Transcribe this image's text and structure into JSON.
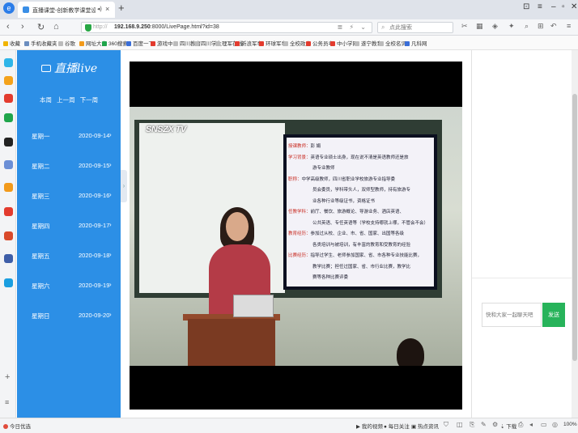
{
  "browser": {
    "tab_title": "直播课堂-创新教学课堂设计",
    "url_prefix": "http://",
    "url_host": "192.168.9.250",
    "url_rest": ":8000/LivePage.html?id=38",
    "search_placeholder": "点此搜索",
    "new_tab": "+",
    "win_controls": [
      "⊡",
      "☰",
      "–",
      "❐",
      "✕"
    ]
  },
  "bookmarks": [
    {
      "label": "收藏",
      "color": "#f0b400"
    },
    {
      "label": "手机收藏夹",
      "color": "#6c8ebf"
    },
    {
      "label": "谷歌",
      "color": "#bbbbbb"
    },
    {
      "label": "网址大全",
      "color": "#f29a1b"
    },
    {
      "label": "360搜索",
      "color": "#1fa54b"
    },
    {
      "label": "百度一下",
      "color": "#3a6ed8"
    },
    {
      "label": "游戏中心",
      "color": "#e33b2e"
    },
    {
      "label": "四川教育",
      "color": "#bbbbbb"
    },
    {
      "label": "四川学生",
      "color": "#bbbbbb"
    },
    {
      "label": "理军在线",
      "color": "#bbbbbb"
    },
    {
      "label": "新浪军事",
      "color": "#e33b2e"
    },
    {
      "label": "环球军事",
      "color": "#e33b2e"
    },
    {
      "label": "全校政府",
      "color": "#bbbbbb"
    },
    {
      "label": "公务员考",
      "color": "#e33b2e"
    },
    {
      "label": "中小学网",
      "color": "#e33b2e"
    },
    {
      "label": "遂宁教育",
      "color": "#bbbbbb"
    },
    {
      "label": "全校名词",
      "color": "#bbbbbb"
    },
    {
      "label": "凡科网",
      "color": "#3a6ed8"
    }
  ],
  "nav": {
    "logo_text": "直播live",
    "week_links": [
      "本周",
      "上一周",
      "下一周"
    ],
    "days": [
      {
        "name": "星期一",
        "date": "2020-09-14"
      },
      {
        "name": "星期二",
        "date": "2020-09-15"
      },
      {
        "name": "星期三",
        "date": "2020-09-16"
      },
      {
        "name": "星期四",
        "date": "2020-09-17"
      },
      {
        "name": "星期五",
        "date": "2020-09-18"
      },
      {
        "name": "星期六",
        "date": "2020-09-19"
      },
      {
        "name": "星期日",
        "date": "2020-09-20"
      }
    ],
    "arrow": "›"
  },
  "video": {
    "watermark": "SNSZX TV",
    "slide_rows": [
      {
        "key": "授课教师：",
        "text": "彭  娟"
      },
      {
        "key": "学习背景：",
        "text": "英语专业硕士出身，现在说不清是英语教师还是旅"
      },
      {
        "key": "",
        "text": "游专业教师"
      },
      {
        "key": "职称：",
        "text": "中学高级教师，四川省职业学校旅游专业指导委"
      },
      {
        "key": "",
        "text": "员会委员，学科带头人，双师型教师，持有旅游专"
      },
      {
        "key": "",
        "text": "业各种行业等级证书，资格证书"
      },
      {
        "key": "任教学科：",
        "text": "前厅、餐饮、旅游概论、导游业务、酒店英语、"
      },
      {
        "key": "",
        "text": "公共英语、专任英语等（学校支持哪就上哪，不管会不会）"
      },
      {
        "key": "教育经历：",
        "text": "参加过从校、企业、市、省、国家、出国等各级"
      },
      {
        "key": "",
        "text": "各类培训与被培训，有丰富的教育和受教育的经验"
      },
      {
        "key": "比赛经历：",
        "text": "指导过学生、老师参加国家、省、市各种专业技能比赛，"
      },
      {
        "key": "",
        "text": "教学比赛；担任过国家、省、市行业比赛，教学比"
      },
      {
        "key": "",
        "text": "赛等各种比赛评委"
      }
    ]
  },
  "chat": {
    "input_placeholder": "快和大家一起聊天吧",
    "send_label": "发送"
  },
  "statusbar": {
    "left": "今日优选",
    "items": [
      "我的视频",
      "每日关注",
      "热点资讯"
    ],
    "download": "下载",
    "zoom": "100%"
  }
}
